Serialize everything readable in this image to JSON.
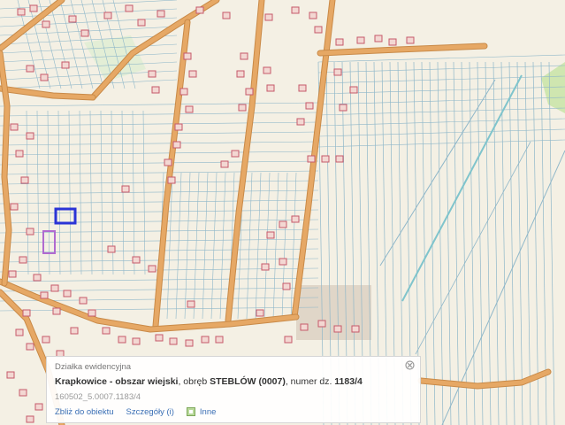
{
  "map": {
    "colors": {
      "background": "#f4f0e4",
      "parcel_lines": "#8fb7c9",
      "road_fill": "#e6a865",
      "road_edge": "#c98a48",
      "building_outline": "#c65a6a",
      "building_fill": "#f3d7d2",
      "selected_parcel": "#2b34d6",
      "secondary_parcel": "#b06ad0",
      "forest_fill": "#cfe6b0",
      "industrial_fill": "#e0d6c8",
      "canal": "#7fc4cc"
    }
  },
  "popup": {
    "header": "Działka ewidencyjna",
    "title": {
      "locality": "Krapkowice - obszar wiejski",
      "obreb_label": ", obręb ",
      "obreb": "STEBLÓW (0007)",
      "numer_label": ", numer dz. ",
      "numer": "1183/4"
    },
    "parcel_id": "160502_5.0007.1183/4",
    "actions": {
      "zoom": "Zbliż do obiektu",
      "details": "Szczegóły (i)",
      "other": "Inne"
    },
    "close_icon": "close-icon",
    "other_icon": "layers-icon"
  }
}
